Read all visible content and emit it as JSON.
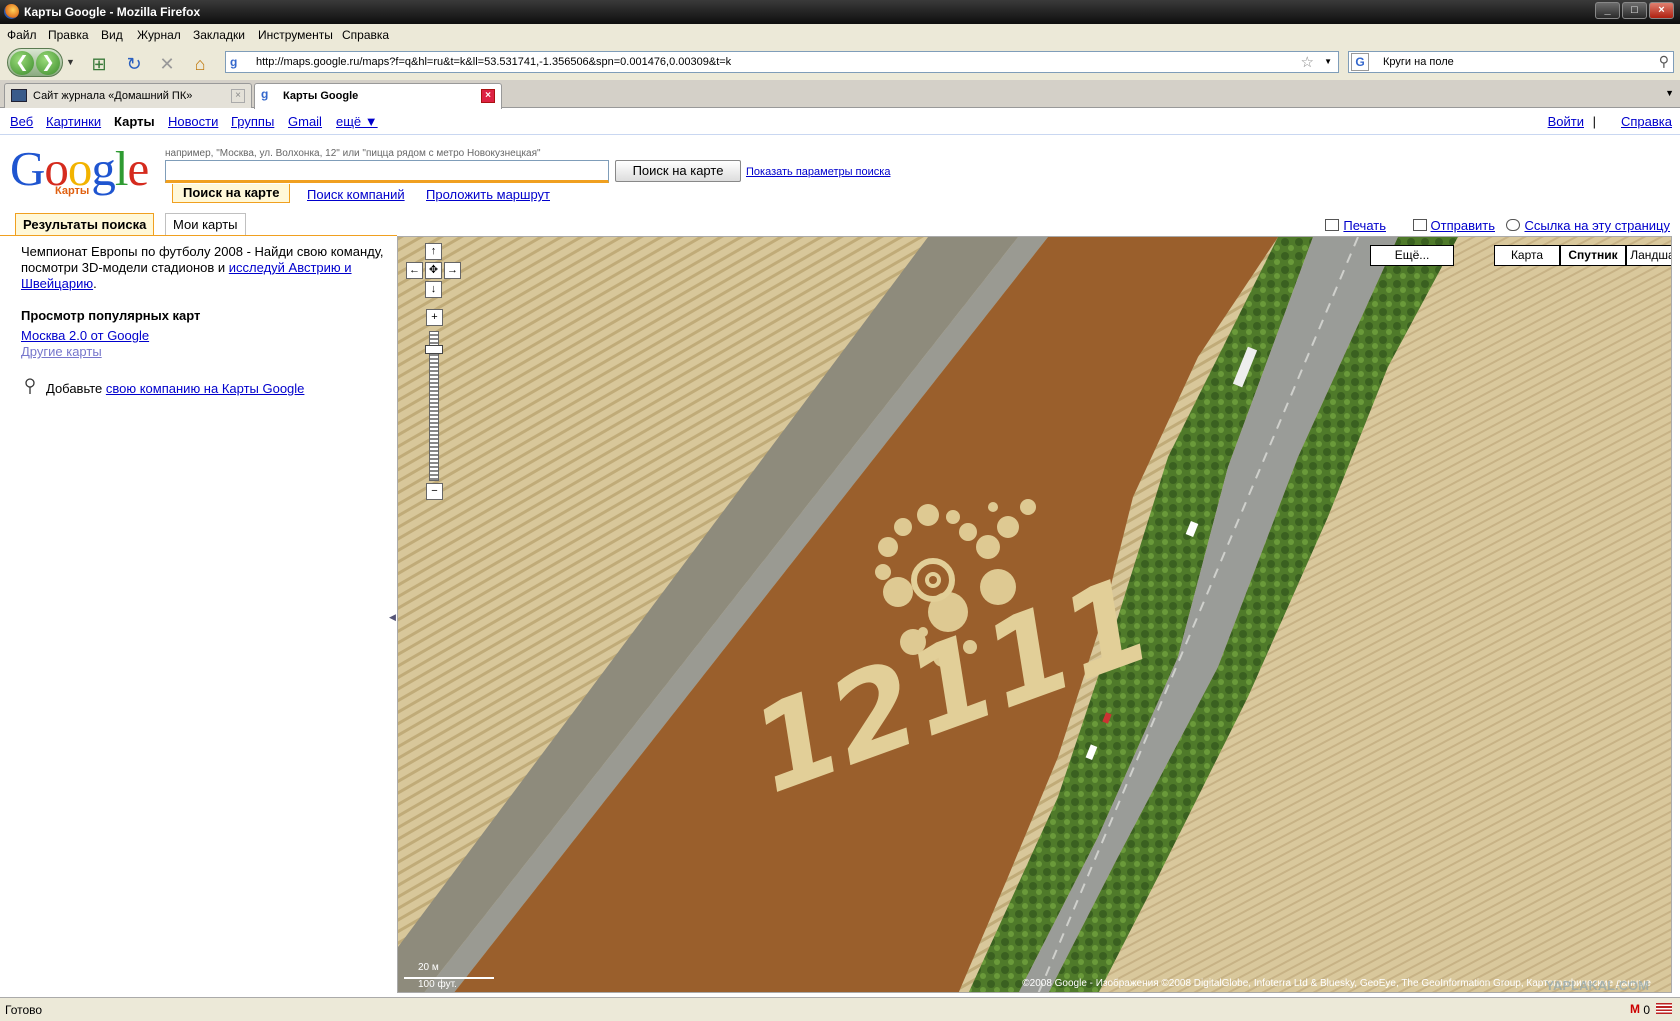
{
  "window": {
    "title": "Карты Google - Mozilla Firefox",
    "controls": [
      "_",
      "□",
      "×"
    ]
  },
  "menu": [
    "Файл",
    "Правка",
    "Вид",
    "Журнал",
    "Закладки",
    "Инструменты",
    "Справка"
  ],
  "navbar": {
    "url": "http://maps.google.ru/maps?f=q&hl=ru&t=k&ll=53.531741,-1.356506&spn=0.001476,0.00309&t=k",
    "search_value": "Круги на поле"
  },
  "tabs": [
    {
      "label": "Сайт журнала «Домашний ПК»",
      "active": false
    },
    {
      "label": "Карты Google",
      "active": true
    }
  ],
  "gbar": {
    "left": [
      "Веб",
      "Картинки",
      "Карты",
      "Новости",
      "Группы",
      "Gmail",
      "ещё ▼"
    ],
    "current": "Карты",
    "signin": "Войти",
    "separator": "|",
    "help": "Справка"
  },
  "logo": {
    "word": "Google",
    "sub": "Карты"
  },
  "search": {
    "hint": "например, \"Москва, ул. Волхонка, 12\" или \"пицца рядом с метро Новокузнецкая\"",
    "value": "",
    "button": "Поиск на карте",
    "advanced": "Показать параметры поиска",
    "tabs": [
      "Поиск на карте",
      "Поиск компаний",
      "Проложить маршрут"
    ]
  },
  "panel_tabs": [
    "Результаты поиска",
    "Мои карты"
  ],
  "top_links": [
    "Печать",
    "Отправить",
    "Ссылка на эту страницу"
  ],
  "left": {
    "promo_text": "Чемпионат Европы по футболу 2008 - Найди свою команду, посмотри 3D-модели стадионов и ",
    "promo_link": "исследуй Австрию и Швейцарию",
    "promo_end": ".",
    "popular_heading": "Просмотр популярных карт",
    "popular_link": "Москва 2.0 от Google",
    "other_maps": "Другие карты",
    "add_text": "Добавьте ",
    "add_link": "свою компанию на Карты Google"
  },
  "map": {
    "types": [
      "Ещё...",
      "Карта",
      "Спутник",
      "Ландшафт"
    ],
    "selected_type": "Спутник",
    "crop_text": "12111",
    "scale": {
      "metric": "20 м",
      "imperial": "100 фут."
    },
    "copyright": "©2008 Google - Изображения ©2008 DigitalGlobe, Infoterra Ltd & Bluesky, GeoEye, The GeoInformation Group, Картографические данные",
    "watermark": "YAPLAKAL.COM",
    "pan_controls": {
      "up": "↑",
      "left": "←",
      "center": "✥",
      "right": "→",
      "down": "↓"
    },
    "zoom_controls": {
      "in": "+",
      "out": "−"
    }
  },
  "status": {
    "text": "Готово",
    "mail_icon": "M",
    "mail_count": "0"
  }
}
